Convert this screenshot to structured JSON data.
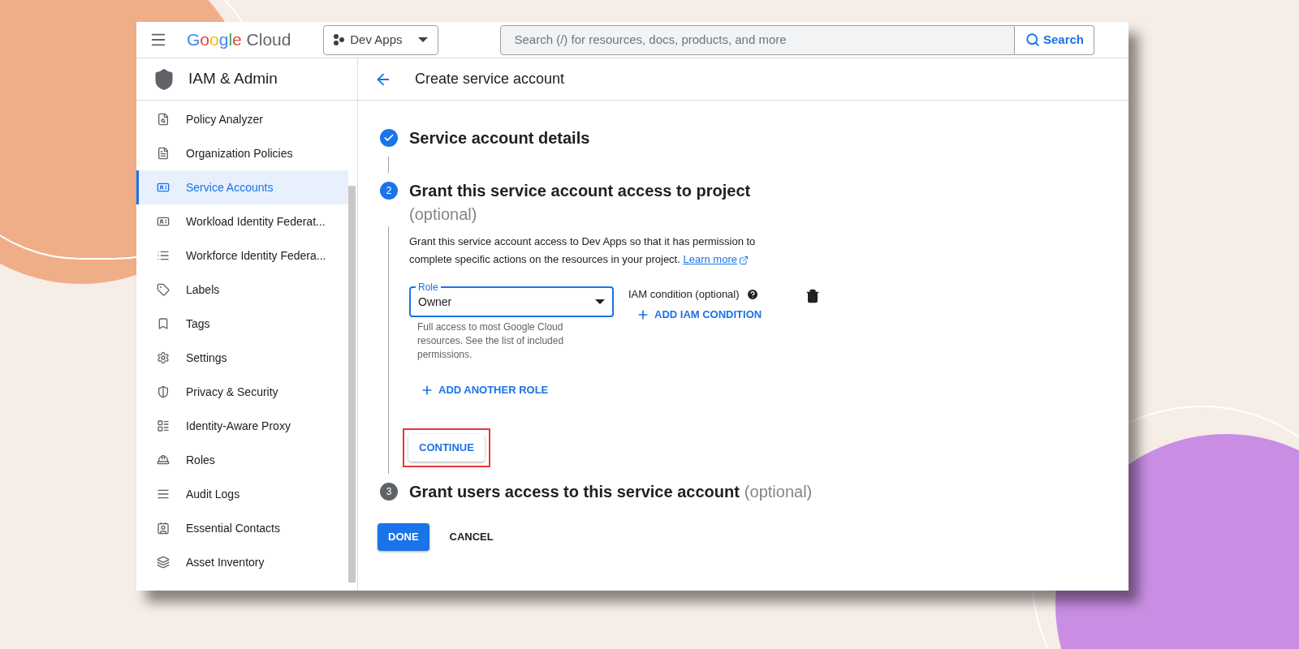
{
  "topbar": {
    "logo": {
      "brand": "Google",
      "product": "Cloud"
    },
    "project": "Dev Apps",
    "search": {
      "placeholder": "Search (/) for resources, docs, products, and more",
      "button": "Search"
    }
  },
  "sidebar": {
    "title": "IAM & Admin",
    "items": [
      {
        "label": "Policy Analyzer",
        "selected": false
      },
      {
        "label": "Organization Policies",
        "selected": false
      },
      {
        "label": "Service Accounts",
        "selected": true
      },
      {
        "label": "Workload Identity Federat...",
        "selected": false
      },
      {
        "label": "Workforce Identity Federa...",
        "selected": false
      },
      {
        "label": "Labels",
        "selected": false
      },
      {
        "label": "Tags",
        "selected": false
      },
      {
        "label": "Settings",
        "selected": false
      },
      {
        "label": "Privacy & Security",
        "selected": false
      },
      {
        "label": "Identity-Aware Proxy",
        "selected": false
      },
      {
        "label": "Roles",
        "selected": false
      },
      {
        "label": "Audit Logs",
        "selected": false
      },
      {
        "label": "Essential Contacts",
        "selected": false
      },
      {
        "label": "Asset Inventory",
        "selected": false
      }
    ]
  },
  "page": {
    "title": "Create service account",
    "steps": [
      {
        "kind": "done",
        "title": "Service account details"
      },
      {
        "kind": "current",
        "number": "2",
        "title": "Grant this service account access to project",
        "optional": "(optional)",
        "description": "Grant this service account access to Dev Apps so that it has permission to complete specific actions on the resources in your project.",
        "link": "Learn more",
        "role": {
          "label": "Role",
          "value": "Owner",
          "hint": "Full access to most Google Cloud resources. See the list of included permissions."
        },
        "condition": {
          "label": "IAM condition (optional)",
          "button": "ADD IAM CONDITION"
        },
        "add_role": "ADD ANOTHER ROLE",
        "continue": "CONTINUE",
        "continue_highlighted": true
      },
      {
        "kind": "pending",
        "number": "3",
        "title": "Grant users access to this service account",
        "optional": "(optional)"
      }
    ],
    "buttons": [
      {
        "label": "DONE",
        "kind": "primary"
      },
      {
        "label": "CANCEL",
        "kind": "text"
      }
    ]
  }
}
